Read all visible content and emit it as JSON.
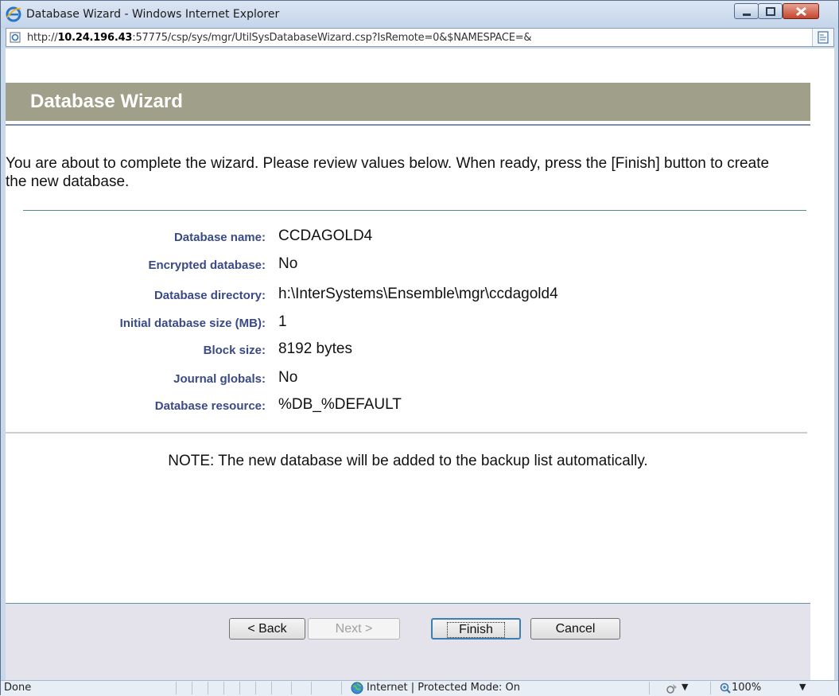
{
  "window": {
    "title": "Database Wizard - Windows Internet Explorer",
    "url_prefix": "http://",
    "url_host": "10.24.196.43",
    "url_rest": ":57775/csp/sys/mgr/UtilSysDatabaseWizard.csp?IsRemote=0&$NAMESPACE=&"
  },
  "header": {
    "title": "Database Wizard"
  },
  "intro": "You are about to complete the wizard. Please review values below. When ready, press the [Finish] button to create the new database.",
  "summary": [
    {
      "label": "Database name:",
      "value": "CCDAGOLD4"
    },
    {
      "label": "Encrypted database:",
      "value": "No"
    },
    {
      "label": "Database directory:",
      "value": "h:\\InterSystems\\Ensemble\\mgr\\ccdagold4"
    },
    {
      "label": "Initial database size (MB):",
      "value": "1"
    },
    {
      "label": "Block size:",
      "value": "8192 bytes"
    },
    {
      "label": "Journal globals:",
      "value": "No"
    },
    {
      "label": "Database resource:",
      "value": "%DB_%DEFAULT"
    }
  ],
  "note": "NOTE: The new database will be added to the backup list automatically.",
  "buttons": {
    "back": "< Back",
    "next": "Next >",
    "finish": "Finish",
    "cancel": "Cancel"
  },
  "status": {
    "done": "Done",
    "zone": "Internet | Protected Mode: On",
    "zoom": "100%"
  },
  "colors": {
    "header_band": "#a09f8a",
    "label": "#3a4a86",
    "footer": "#e4e3ec"
  }
}
